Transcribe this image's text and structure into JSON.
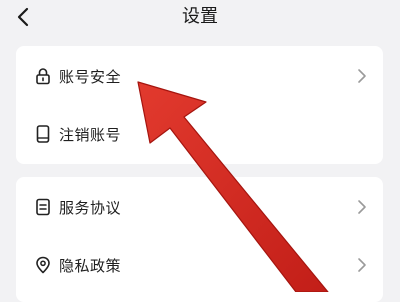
{
  "header": {
    "title": "设置"
  },
  "sections": [
    {
      "items": [
        {
          "label": "账号安全",
          "icon": "lock-icon",
          "has_chevron": true
        },
        {
          "label": "注销账号",
          "icon": "phone-icon",
          "has_chevron": false
        }
      ]
    },
    {
      "items": [
        {
          "label": "服务协议",
          "icon": "document-icon",
          "has_chevron": true
        },
        {
          "label": "隐私政策",
          "icon": "location-shield-icon",
          "has_chevron": true
        }
      ]
    }
  ],
  "annotation": {
    "icon": "red-arrow-icon",
    "color": "#d2261f",
    "points_to": "账号安全"
  },
  "colors": {
    "background": "#f2f2f4",
    "card": "#ffffff",
    "text": "#1f1f1f",
    "icon": "#222222",
    "chevron": "#9a9a9a"
  }
}
